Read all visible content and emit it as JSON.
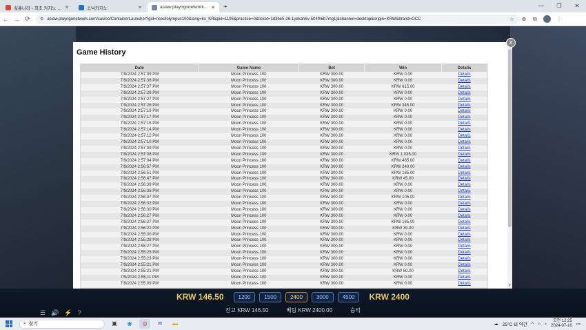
{
  "browser": {
    "tabs": [
      {
        "title": "실홀나라 - 최초 카지노 사이트",
        "favicon_color": "#d44a3a",
        "active": false
      },
      {
        "title": "소닉카지노",
        "favicon_color": "#1f6fd1",
        "active": false
      },
      {
        "title": "asiaw.playngonetwork.com",
        "favicon_color": "#7a8796",
        "active": true
      }
    ],
    "new_tab": "+",
    "url": "asiaw.playngonetwork.com/casino/ContainerLauncher?gid=riseofolympus100&lang=ko_KR&pid=1195&practice=0&ticket=1d3be5-26-1yekah6v-504fh6b7mg1j&channel=desktop&origin=KRW&brand=OCC"
  },
  "modal": {
    "title": "Game History",
    "close": "x",
    "columns": [
      "Date",
      "Game Name",
      "Bet",
      "Win",
      "Details"
    ],
    "rows": [
      [
        "7/9/2024 2:57:39 PM",
        "Moon Princess 100",
        "KRW 300.00",
        "KRW 0.00",
        "Details"
      ],
      [
        "7/9/2024 2:57:38 PM",
        "Moon Princess 100",
        "KRW 300.00",
        "KRW 0.00",
        "Details"
      ],
      [
        "7/9/2024 2:57:37 PM",
        "Moon Princess 100",
        "KRW 300.00",
        "KRW 615.00",
        "Details"
      ],
      [
        "7/9/2024 2:57:29 PM",
        "Moon Princess 100",
        "KRW 300.00",
        "KRW 0.00",
        "Details"
      ],
      [
        "7/9/2024 2:57:27 PM",
        "Moon Princess 100",
        "KRW 300.00",
        "KRW 0.00",
        "Details"
      ],
      [
        "7/9/2024 2:57:26 PM",
        "Moon Princess 100",
        "KRW 300.00",
        "KRW 345.00",
        "Details"
      ],
      [
        "7/9/2024 2:57:19 PM",
        "Moon Princess 100",
        "KRW 300.00",
        "KRW 0.00",
        "Details"
      ],
      [
        "7/9/2024 2:57:17 PM",
        "Moon Princess 100",
        "KRW 300.00",
        "KRW 0.00",
        "Details"
      ],
      [
        "7/9/2024 2:57:15 PM",
        "Moon Princess 100",
        "KRW 300.00",
        "KRW 0.00",
        "Details"
      ],
      [
        "7/9/2024 2:57:14 PM",
        "Moon Princess 100",
        "KRW 300.00",
        "KRW 0.00",
        "Details"
      ],
      [
        "7/9/2024 2:57:12 PM",
        "Moon Princess 100",
        "KRW 300.00",
        "KRW 0.00",
        "Details"
      ],
      [
        "7/9/2024 2:57:10 PM",
        "Moon Princess 100",
        "KRW 300.00",
        "KRW 0.00",
        "Details"
      ],
      [
        "7/9/2024 2:57:09 PM",
        "Moon Princess 100",
        "KRW 300.00",
        "KRW 0.00",
        "Details"
      ],
      [
        "7/9/2024 2:57:08 PM",
        "Moon Princess 100",
        "KRW 300.00",
        "KRW 1,035.00",
        "Details"
      ],
      [
        "7/9/2024 2:57:04 PM",
        "Moon Princess 100",
        "KRW 300.00",
        "KRW 465.00",
        "Details"
      ],
      [
        "7/9/2024 2:56:57 PM",
        "Moon Princess 100",
        "KRW 300.00",
        "KRW 240.00",
        "Details"
      ],
      [
        "7/9/2024 2:56:51 PM",
        "Moon Princess 100",
        "KRW 300.00",
        "KRW 165.00",
        "Details"
      ],
      [
        "7/9/2024 2:56:47 PM",
        "Moon Princess 100",
        "KRW 300.00",
        "KRW 45.00",
        "Details"
      ],
      [
        "7/9/2024 2:56:39 PM",
        "Moon Princess 100",
        "KRW 300.00",
        "KRW 0.00",
        "Details"
      ],
      [
        "7/9/2024 2:56:38 PM",
        "Moon Princess 100",
        "KRW 300.00",
        "KRW 0.00",
        "Details"
      ],
      [
        "7/9/2024 2:56:37 PM",
        "Moon Princess 100",
        "KRW 300.00",
        "KRW 105.00",
        "Details"
      ],
      [
        "7/9/2024 2:56:32 PM",
        "Moon Princess 100",
        "KRW 300.00",
        "KRW 0.00",
        "Details"
      ],
      [
        "7/9/2024 2:56:30 PM",
        "Moon Princess 100",
        "KRW 300.00",
        "KRW 0.00",
        "Details"
      ],
      [
        "7/9/2024 2:56:27 PM",
        "Moon Princess 100",
        "KRW 300.00",
        "KRW 0.00",
        "Details"
      ],
      [
        "7/9/2024 2:56:27 PM",
        "Moon Princess 100",
        "KRW 300.00",
        "KRW 165.00",
        "Details"
      ],
      [
        "7/9/2024 2:56:22 PM",
        "Moon Princess 100",
        "KRW 300.00",
        "KRW 30.00",
        "Details"
      ],
      [
        "7/9/2024 2:55:30 PM",
        "Moon Princess 100",
        "KRW 300.00",
        "KRW 0.00",
        "Details"
      ],
      [
        "7/9/2024 2:55:28 PM",
        "Moon Princess 100",
        "KRW 300.00",
        "KRW 0.00",
        "Details"
      ],
      [
        "7/9/2024 2:55:27 PM",
        "Moon Princess 100",
        "KRW 300.00",
        "KRW 0.00",
        "Details"
      ],
      [
        "7/9/2024 2:55:25 PM",
        "Moon Princess 100",
        "KRW 300.00",
        "KRW 0.00",
        "Details"
      ],
      [
        "7/9/2024 2:55:23 PM",
        "Moon Princess 100",
        "KRW 300.00",
        "KRW 0.00",
        "Details"
      ],
      [
        "7/9/2024 2:55:21 PM",
        "Moon Princess 100",
        "KRW 300.00",
        "KRW 0.00",
        "Details"
      ],
      [
        "7/9/2024 2:55:21 PM",
        "Moon Princess 100",
        "KRW 300.00",
        "KRW 60.00",
        "Details"
      ],
      [
        "7/9/2024 2:55:11 PM",
        "Moon Princess 100",
        "KRW 300.00",
        "KRW 0.00",
        "Details"
      ],
      [
        "7/9/2024 2:55:09 PM",
        "Moon Princess 100",
        "KRW 300.00",
        "KRW 0.00",
        "Details"
      ]
    ]
  },
  "game": {
    "balance_big": "KRW 146.50",
    "bet_big": "KRW 2400",
    "chips": [
      "1200",
      "1500",
      "2400",
      "3000",
      "4500"
    ],
    "selected_chip": "2400",
    "balance_label": "잔고",
    "balance_value": "KRW 146.50",
    "bet_label": "베팅",
    "bet_value": "KRW 2400.00",
    "win_label": "승리"
  },
  "taskbar": {
    "search_placeholder": "찾기",
    "weather": "25°C 비 약간",
    "time": "오전 12:25",
    "date": "2024-07-10"
  }
}
